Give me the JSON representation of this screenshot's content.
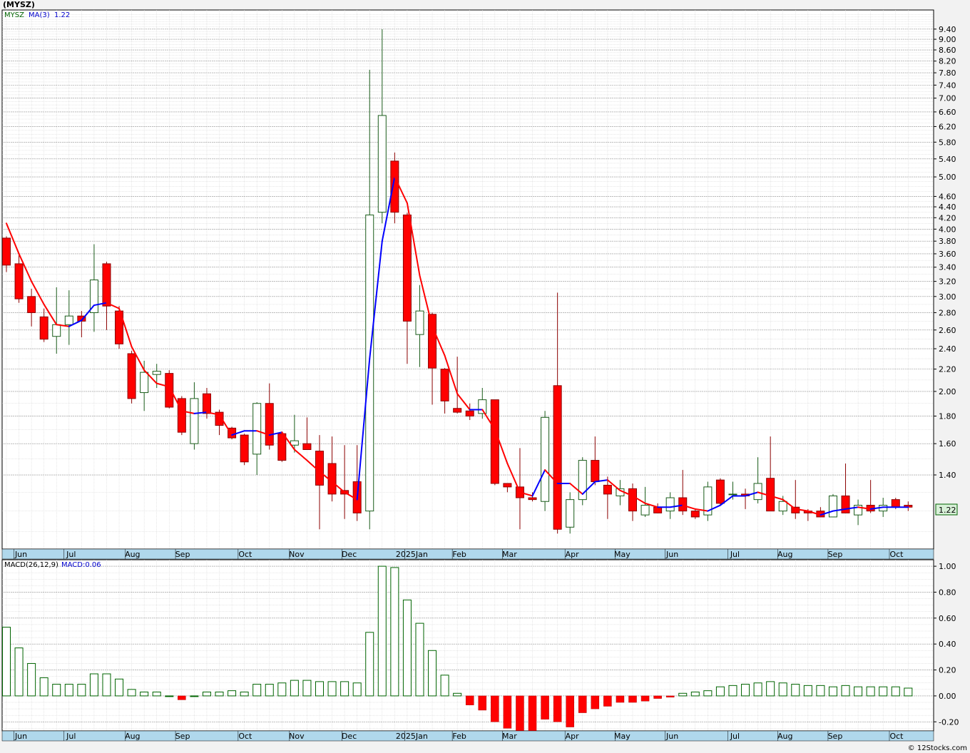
{
  "header": {
    "symbol_title": "(MYSZ)"
  },
  "legend_price": {
    "symbol": "MYSZ",
    "ma_label": "MA(3)",
    "ma_value": "1.22"
  },
  "legend_macd": {
    "macd_label": "MACD(26,12,9)",
    "macd_value": "MACD:0.06"
  },
  "last_price_label": "1.22",
  "watermark": "© 12Stocks.com",
  "colors": {
    "up_body": "#ffffff",
    "up_border": "#1a5c1a",
    "down_body": "#ff0000",
    "down_border": "#8b0000",
    "ma_down": "#ff0000",
    "ma_up": "#0000ff",
    "macd_pos_border": "#006400",
    "macd_neg": "#ff0000",
    "axis_bg": "#b0d8ec"
  },
  "chart_data": [
    {
      "type": "candlestick",
      "name": "price",
      "y_scale": "log",
      "ylim": [
        1.02,
        10.2
      ],
      "yticks": [
        1.4,
        1.6,
        1.8,
        2.0,
        2.2,
        2.4,
        2.6,
        2.8,
        3.0,
        3.2,
        3.4,
        3.6,
        3.8,
        4.0,
        4.2,
        4.4,
        4.6,
        5.0,
        5.4,
        5.8,
        6.2,
        6.6,
        7.0,
        7.4,
        7.8,
        8.2,
        8.6,
        9.0,
        9.4
      ],
      "ytick_labels": [
        "1.40",
        "1.60",
        "1.80",
        "2.00",
        "2.20",
        "2.40",
        "2.60",
        "2.80",
        "3.00",
        "3.20",
        "3.40",
        "3.60",
        "3.80",
        "4.00",
        "4.20",
        "4.40",
        "4.60",
        "5.00",
        "5.40",
        "5.80",
        "6.20",
        "6.60",
        "7.00",
        "7.40",
        "7.80",
        "8.20",
        "8.60",
        "9.00",
        "9.40"
      ],
      "x_labels": [
        {
          "label": "Jun",
          "index": 0.6
        },
        {
          "label": "Jul",
          "index": 4.6
        },
        {
          "label": "Aug",
          "index": 9.5
        },
        {
          "label": "Sep",
          "index": 13.5
        },
        {
          "label": "Oct",
          "index": 18.5
        },
        {
          "label": "Nov",
          "index": 22.6
        },
        {
          "label": "Dec",
          "index": 26.8
        },
        {
          "label": "2025Jan",
          "index": 31.8
        },
        {
          "label": "Feb",
          "index": 35.6
        },
        {
          "label": "Mar",
          "index": 39.6
        },
        {
          "label": "Apr",
          "index": 44.6
        },
        {
          "label": "May",
          "index": 48.6
        },
        {
          "label": "Jun",
          "index": 52.6
        },
        {
          "label": "Jul",
          "index": 57.6
        },
        {
          "label": "Aug",
          "index": 61.6
        },
        {
          "label": "Sep",
          "index": 65.6
        },
        {
          "label": "Oct",
          "index": 70.5
        }
      ],
      "candles": [
        {
          "o": 3.85,
          "h": 3.88,
          "l": 3.33,
          "c": 3.43
        },
        {
          "o": 3.45,
          "h": 3.58,
          "l": 2.92,
          "c": 2.97
        },
        {
          "o": 3.0,
          "h": 3.1,
          "l": 2.64,
          "c": 2.8
        },
        {
          "o": 2.75,
          "h": 2.85,
          "l": 2.47,
          "c": 2.5
        },
        {
          "o": 2.53,
          "h": 3.12,
          "l": 2.35,
          "c": 2.66
        },
        {
          "o": 2.66,
          "h": 3.08,
          "l": 2.44,
          "c": 2.76
        },
        {
          "o": 2.76,
          "h": 2.82,
          "l": 2.52,
          "c": 2.7
        },
        {
          "o": 2.8,
          "h": 3.75,
          "l": 2.58,
          "c": 3.22
        },
        {
          "o": 3.45,
          "h": 3.48,
          "l": 2.6,
          "c": 2.88
        },
        {
          "o": 2.82,
          "h": 2.88,
          "l": 2.4,
          "c": 2.45
        },
        {
          "o": 2.35,
          "h": 2.38,
          "l": 1.9,
          "c": 1.94
        },
        {
          "o": 1.99,
          "h": 2.28,
          "l": 1.84,
          "c": 2.17
        },
        {
          "o": 2.15,
          "h": 2.25,
          "l": 2.03,
          "c": 2.18
        },
        {
          "o": 2.16,
          "h": 2.19,
          "l": 1.86,
          "c": 1.87
        },
        {
          "o": 1.94,
          "h": 1.96,
          "l": 1.66,
          "c": 1.68
        },
        {
          "o": 1.6,
          "h": 2.08,
          "l": 1.56,
          "c": 1.94
        },
        {
          "o": 1.98,
          "h": 2.03,
          "l": 1.78,
          "c": 1.82
        },
        {
          "o": 1.83,
          "h": 1.85,
          "l": 1.66,
          "c": 1.73
        },
        {
          "o": 1.71,
          "h": 1.72,
          "l": 1.63,
          "c": 1.64
        },
        {
          "o": 1.66,
          "h": 1.67,
          "l": 1.46,
          "c": 1.48
        },
        {
          "o": 1.53,
          "h": 1.91,
          "l": 1.4,
          "c": 1.9
        },
        {
          "o": 1.9,
          "h": 2.07,
          "l": 1.56,
          "c": 1.59
        },
        {
          "o": 1.67,
          "h": 1.68,
          "l": 1.48,
          "c": 1.49
        },
        {
          "o": 1.59,
          "h": 1.81,
          "l": 1.54,
          "c": 1.62
        },
        {
          "o": 1.6,
          "h": 1.79,
          "l": 1.57,
          "c": 1.56
        },
        {
          "o": 1.55,
          "h": 1.66,
          "l": 1.11,
          "c": 1.34
        },
        {
          "o": 1.47,
          "h": 1.65,
          "l": 1.25,
          "c": 1.29
        },
        {
          "o": 1.31,
          "h": 1.59,
          "l": 1.16,
          "c": 1.29
        },
        {
          "o": 1.36,
          "h": 1.59,
          "l": 1.15,
          "c": 1.19
        },
        {
          "o": 1.2,
          "h": 7.9,
          "l": 1.11,
          "c": 4.25
        },
        {
          "o": 4.3,
          "h": 9.4,
          "l": 4.1,
          "c": 6.5
        },
        {
          "o": 5.35,
          "h": 5.55,
          "l": 4.1,
          "c": 4.3
        },
        {
          "o": 4.25,
          "h": 4.29,
          "l": 2.25,
          "c": 2.7
        },
        {
          "o": 2.55,
          "h": 3.15,
          "l": 2.22,
          "c": 2.82
        },
        {
          "o": 2.78,
          "h": 2.8,
          "l": 1.89,
          "c": 2.21
        },
        {
          "o": 2.2,
          "h": 2.21,
          "l": 1.82,
          "c": 1.92
        },
        {
          "o": 1.86,
          "h": 2.32,
          "l": 1.82,
          "c": 1.83
        },
        {
          "o": 1.84,
          "h": 1.9,
          "l": 1.77,
          "c": 1.8
        },
        {
          "o": 1.82,
          "h": 2.03,
          "l": 1.78,
          "c": 1.93
        },
        {
          "o": 1.93,
          "h": 1.93,
          "l": 1.34,
          "c": 1.35
        },
        {
          "o": 1.35,
          "h": 1.35,
          "l": 1.3,
          "c": 1.33
        },
        {
          "o": 1.33,
          "h": 1.57,
          "l": 1.11,
          "c": 1.27
        },
        {
          "o": 1.27,
          "h": 1.3,
          "l": 1.25,
          "c": 1.26
        },
        {
          "o": 1.25,
          "h": 1.84,
          "l": 1.2,
          "c": 1.79
        },
        {
          "o": 2.05,
          "h": 3.05,
          "l": 1.09,
          "c": 1.11
        },
        {
          "o": 1.12,
          "h": 1.3,
          "l": 1.09,
          "c": 1.26
        },
        {
          "o": 1.26,
          "h": 1.51,
          "l": 1.23,
          "c": 1.49
        },
        {
          "o": 1.49,
          "h": 1.65,
          "l": 1.34,
          "c": 1.36
        },
        {
          "o": 1.34,
          "h": 1.39,
          "l": 1.16,
          "c": 1.29
        },
        {
          "o": 1.28,
          "h": 1.37,
          "l": 1.23,
          "c": 1.32
        },
        {
          "o": 1.32,
          "h": 1.35,
          "l": 1.15,
          "c": 1.2
        },
        {
          "o": 1.18,
          "h": 1.33,
          "l": 1.17,
          "c": 1.23
        },
        {
          "o": 1.22,
          "h": 1.24,
          "l": 1.19,
          "c": 1.19
        },
        {
          "o": 1.2,
          "h": 1.3,
          "l": 1.16,
          "c": 1.27
        },
        {
          "o": 1.27,
          "h": 1.43,
          "l": 1.18,
          "c": 1.2
        },
        {
          "o": 1.2,
          "h": 1.21,
          "l": 1.16,
          "c": 1.17
        },
        {
          "o": 1.18,
          "h": 1.36,
          "l": 1.15,
          "c": 1.33
        },
        {
          "o": 1.37,
          "h": 1.38,
          "l": 1.23,
          "c": 1.24
        },
        {
          "o": 1.29,
          "h": 1.36,
          "l": 1.26,
          "c": 1.29
        },
        {
          "o": 1.29,
          "h": 1.32,
          "l": 1.21,
          "c": 1.28
        },
        {
          "o": 1.26,
          "h": 1.51,
          "l": 1.24,
          "c": 1.35
        },
        {
          "o": 1.38,
          "h": 1.65,
          "l": 1.2,
          "c": 1.2
        },
        {
          "o": 1.2,
          "h": 1.28,
          "l": 1.18,
          "c": 1.25
        },
        {
          "o": 1.22,
          "h": 1.37,
          "l": 1.16,
          "c": 1.19
        },
        {
          "o": 1.2,
          "h": 1.21,
          "l": 1.15,
          "c": 1.19
        },
        {
          "o": 1.2,
          "h": 1.22,
          "l": 1.17,
          "c": 1.17
        },
        {
          "o": 1.17,
          "h": 1.29,
          "l": 1.17,
          "c": 1.28
        },
        {
          "o": 1.28,
          "h": 1.47,
          "l": 1.19,
          "c": 1.19
        },
        {
          "o": 1.18,
          "h": 1.26,
          "l": 1.13,
          "c": 1.23
        },
        {
          "o": 1.23,
          "h": 1.37,
          "l": 1.19,
          "c": 1.2
        },
        {
          "o": 1.2,
          "h": 1.27,
          "l": 1.17,
          "c": 1.23
        },
        {
          "o": 1.26,
          "h": 1.27,
          "l": 1.21,
          "c": 1.22
        },
        {
          "o": 1.23,
          "h": 1.25,
          "l": 1.2,
          "c": 1.22
        }
      ],
      "ma3": [
        4.1,
        3.6,
        3.2,
        2.9,
        2.66,
        2.64,
        2.71,
        2.89,
        2.92,
        2.85,
        2.42,
        2.19,
        2.07,
        2.04,
        1.84,
        1.82,
        1.83,
        1.81,
        1.66,
        1.69,
        1.69,
        1.66,
        1.68,
        1.56,
        1.49,
        1.42,
        1.36,
        1.3,
        1.26,
        2.3,
        3.8,
        5.0,
        4.47,
        3.28,
        2.64,
        2.33,
        1.98,
        1.85,
        1.85,
        1.7,
        1.47,
        1.3,
        1.28,
        1.43,
        1.35,
        1.35,
        1.29,
        1.36,
        1.37,
        1.31,
        1.28,
        1.24,
        1.22,
        1.22,
        1.23,
        1.21,
        1.2,
        1.23,
        1.28,
        1.28,
        1.3,
        1.28,
        1.26,
        1.21,
        1.2,
        1.18,
        1.2,
        1.21,
        1.22,
        1.21,
        1.22,
        1.22,
        1.22
      ]
    },
    {
      "type": "bar",
      "name": "MACD",
      "ylim": [
        -0.27,
        1.05
      ],
      "yticks": [
        -0.2,
        0.0,
        0.2,
        0.4,
        0.6,
        0.8,
        1.0
      ],
      "ytick_labels": [
        "-0.20",
        "0.00",
        "0.20",
        "0.40",
        "0.60",
        "0.80",
        "1.00"
      ],
      "values": [
        0.53,
        0.37,
        0.25,
        0.14,
        0.09,
        0.09,
        0.09,
        0.17,
        0.17,
        0.13,
        0.05,
        0.03,
        0.03,
        0.0,
        -0.03,
        0.0,
        0.03,
        0.03,
        0.04,
        0.03,
        0.09,
        0.09,
        0.1,
        0.12,
        0.12,
        0.11,
        0.11,
        0.11,
        0.1,
        0.49,
        1.0,
        0.99,
        0.74,
        0.56,
        0.35,
        0.16,
        0.02,
        -0.07,
        -0.11,
        -0.2,
        -0.25,
        -0.27,
        -0.27,
        -0.18,
        -0.2,
        -0.24,
        -0.13,
        -0.1,
        -0.08,
        -0.05,
        -0.05,
        -0.04,
        -0.02,
        -0.01,
        0.02,
        0.03,
        0.04,
        0.07,
        0.08,
        0.09,
        0.1,
        0.11,
        0.1,
        0.09,
        0.08,
        0.08,
        0.07,
        0.08,
        0.07,
        0.07,
        0.07,
        0.07,
        0.06
      ]
    }
  ]
}
